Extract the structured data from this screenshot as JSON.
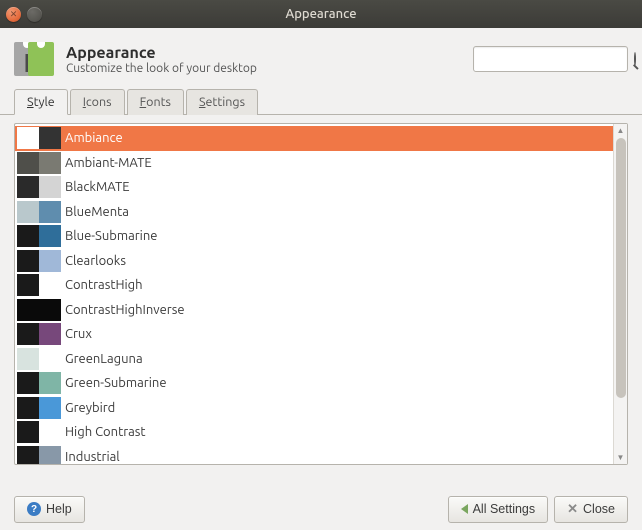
{
  "window": {
    "title": "Appearance"
  },
  "header": {
    "title": "Appearance",
    "subtitle": "Customize the look of your desktop"
  },
  "search": {
    "placeholder": ""
  },
  "tabs": [
    {
      "label": "Style",
      "mn": "S",
      "rest": "tyle",
      "active": true
    },
    {
      "label": "Icons",
      "mn": "I",
      "rest": "cons",
      "active": false
    },
    {
      "label": "Fonts",
      "mn": "F",
      "rest": "onts",
      "active": false
    },
    {
      "label": "Settings",
      "mn": "S",
      "rest": "ettings",
      "active": false
    }
  ],
  "themes": [
    {
      "name": "Ambiance",
      "c1": "#ffffff",
      "c2": "#333333",
      "selected": true
    },
    {
      "name": "Ambiant-MATE",
      "c1": "#4f4f4a",
      "c2": "#7a7a72",
      "selected": false
    },
    {
      "name": "BlackMATE",
      "c1": "#2a2a2a",
      "c2": "#d4d4d4",
      "selected": false
    },
    {
      "name": "BlueMenta",
      "c1": "#b9c8cc",
      "c2": "#5f8dae",
      "selected": false
    },
    {
      "name": "Blue-Submarine",
      "c1": "#1a1a1a",
      "c2": "#2f6e9a",
      "selected": false
    },
    {
      "name": "Clearlooks",
      "c1": "#1a1a1a",
      "c2": "#a0b8d8",
      "selected": false
    },
    {
      "name": "ContrastHigh",
      "c1": "#1a1a1a",
      "c2": "#ffffff",
      "selected": false
    },
    {
      "name": "ContrastHighInverse",
      "c1": "#0a0a0a",
      "c2": "#0a0a0a",
      "selected": false
    },
    {
      "name": "Crux",
      "c1": "#1a1a1a",
      "c2": "#77487b",
      "selected": false
    },
    {
      "name": "GreenLaguna",
      "c1": "#d8e3df",
      "c2": "#ffffff",
      "selected": false
    },
    {
      "name": "Green-Submarine",
      "c1": "#1a1a1a",
      "c2": "#7fb5a6",
      "selected": false
    },
    {
      "name": "Greybird",
      "c1": "#1a1a1a",
      "c2": "#4a98d8",
      "selected": false
    },
    {
      "name": "High Contrast",
      "c1": "#1a1a1a",
      "c2": "#ffffff",
      "selected": false
    },
    {
      "name": "Industrial",
      "c1": "#1a1a1a",
      "c2": "#8898a8",
      "selected": false
    }
  ],
  "footer": {
    "help": "Help",
    "allSettings": "All Settings",
    "close": "Close"
  }
}
